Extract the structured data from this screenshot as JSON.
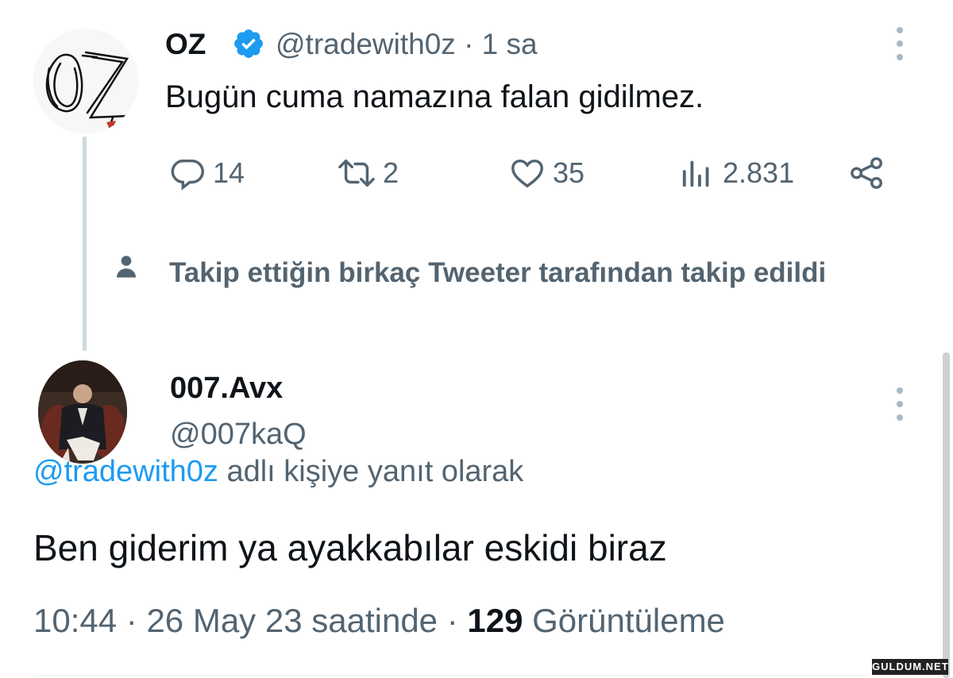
{
  "tweet": {
    "author_name": "OZ",
    "verified": true,
    "handle": "@tradewith0z",
    "separator": "·",
    "time": "1 sa",
    "text": "Bugün cuma namazına falan gidilmez.",
    "actions": {
      "replies": "14",
      "retweets": "2",
      "likes": "35",
      "views": "2.831"
    },
    "social_context": "Takip ettiğin birkaç Tweeter tarafından takip edildi"
  },
  "reply": {
    "author_name": "007.Avx",
    "handle": "@007kaQ",
    "reply_to_link": "@tradewith0z",
    "reply_to_suffix": " adlı kişiye yanıt olarak",
    "text": "Ben giderim ya ayakkabılar eskidi biraz",
    "time": "10:44",
    "date": "26 May 23 saatinde",
    "separator": "·",
    "view_count": "129",
    "view_label": "Görüntüleme"
  },
  "watermark": "GULDUM.NET",
  "colors": {
    "accent": "#1d9bf0",
    "secondary_text": "#536471",
    "primary_text": "#0f1419",
    "thread_line": "#cfd9de"
  },
  "icons": [
    "reply-icon",
    "retweet-icon",
    "like-icon",
    "views-icon",
    "share-icon",
    "verified-badge-icon",
    "person-icon",
    "more-icon"
  ]
}
